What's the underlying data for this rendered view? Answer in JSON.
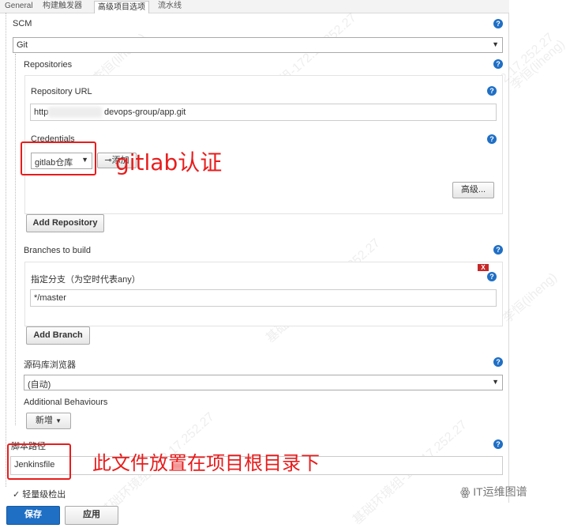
{
  "tabs": [
    {
      "label": "General",
      "active": false
    },
    {
      "label": "构建触发器",
      "active": false
    },
    {
      "label": "高级项目选项",
      "active": true
    },
    {
      "label": "流水线",
      "active": false
    }
  ],
  "scm": {
    "label": "SCM",
    "selected": "Git",
    "repositories": {
      "label": "Repositories",
      "url_label": "Repository URL",
      "url_prefix": "http",
      "url_suffix": "devops-group/app.git",
      "credentials_label": "Credentials",
      "credentials_selected": "gitlab仓库",
      "add_label": "添加",
      "advanced_label": "高级...",
      "add_repository_label": "Add Repository"
    },
    "branches": {
      "label": "Branches to build",
      "spec_label": "指定分支（为空时代表any）",
      "spec_value": "*/master",
      "delete_label": "X",
      "add_branch_label": "Add Branch"
    },
    "browser": {
      "label": "源码库浏览器",
      "selected": "(自动)"
    },
    "behaviours": {
      "label": "Additional Behaviours",
      "add_label": "新增"
    }
  },
  "script_path": {
    "label": "脚本路径",
    "value": "Jenkinsfile"
  },
  "lightweight_label": "轻量级检出",
  "footer": {
    "save_label": "保存",
    "apply_label": "应用"
  },
  "annotations": {
    "credentials_note": "gitlab认证",
    "script_note": "此文件放置在项目根目录下"
  },
  "watermark": {
    "author": "李恒(liheng)",
    "ip": "基础环境组-172.17.252.27"
  },
  "brand": {
    "name": "IT运维图谱"
  },
  "colors": {
    "help": "#1f6fc5",
    "annotation": "#e81c1c",
    "save_button": "#1f6fc5"
  }
}
